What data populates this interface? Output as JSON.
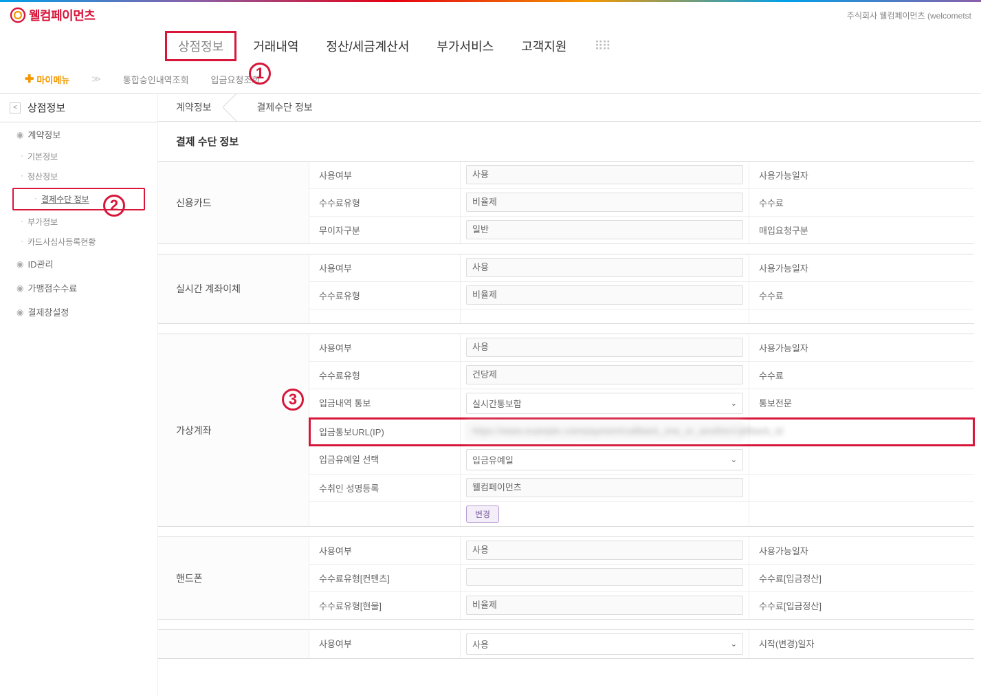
{
  "header": {
    "logo_text": "웰컴페이먼츠",
    "company": "주식회사 웰컴페이먼츠 (welcometst"
  },
  "mainnav": {
    "items": [
      "상점정보",
      "거래내역",
      "정산/세금계산서",
      "부가서비스",
      "고객지원"
    ],
    "active_index": 0
  },
  "submenu": {
    "mymenu": "마이메뉴",
    "items": [
      "통합승인내역조회",
      "입금요청조회"
    ]
  },
  "breadcrumb": [
    "계약정보",
    "결제수단 정보"
  ],
  "sidebar": {
    "title": "상점정보",
    "categories": [
      {
        "label": "계약정보",
        "subs": [
          "기본정보",
          "정산정보",
          "결제수단 정보",
          "부가정보",
          "카드사심사등록현황"
        ],
        "active_sub": 2
      },
      {
        "label": "ID관리",
        "subs": []
      },
      {
        "label": "가맹점수수료",
        "subs": []
      },
      {
        "label": "결제창설정",
        "subs": []
      }
    ]
  },
  "page_title": "결제 수단 정보",
  "annotations": {
    "a1": "1",
    "a2": "2",
    "a3": "3"
  },
  "sections": [
    {
      "name": "credit-card",
      "label": "신용카드",
      "rows": [
        {
          "label": "사용여부",
          "value": "사용",
          "type": "box",
          "right": "사용가능일자"
        },
        {
          "label": "수수료유형",
          "value": "비율제",
          "type": "box",
          "right": "수수료"
        },
        {
          "label": "무이자구분",
          "value": "일반",
          "type": "box",
          "right": "매입요청구분"
        }
      ]
    },
    {
      "name": "realtime-transfer",
      "label": "실시간 계좌이체",
      "rows": [
        {
          "label": "사용여부",
          "value": "사용",
          "type": "box",
          "right": "사용가능일자"
        },
        {
          "label": "수수료유형",
          "value": "비율제",
          "type": "box",
          "right": "수수료"
        },
        {
          "label": "",
          "value": "",
          "type": "empty",
          "right": ""
        }
      ]
    },
    {
      "name": "virtual-account",
      "label": "가상계좌",
      "rows": [
        {
          "label": "사용여부",
          "value": "사용",
          "type": "box",
          "right": "사용가능일자"
        },
        {
          "label": "수수료유형",
          "value": "건당제",
          "type": "box",
          "right": "수수료"
        },
        {
          "label": "입금내역 통보",
          "value": "실시간통보함",
          "type": "select",
          "right": "통보전문"
        },
        {
          "label": "입금통보URL(IP)",
          "value": "https://www.example.com/payment/callback_one_or_another/callback_id",
          "type": "box-blur",
          "right": "",
          "highlight": true
        },
        {
          "label": "입금유예일 선택",
          "value": "입금유예일",
          "type": "select",
          "right": ""
        },
        {
          "label": "수취인 성명등록",
          "value": "웰컴페이먼츠",
          "type": "box",
          "right": ""
        },
        {
          "label": "",
          "value": "변경",
          "type": "button",
          "right": ""
        }
      ]
    },
    {
      "name": "mobile",
      "label": "핸드폰",
      "rows": [
        {
          "label": "사용여부",
          "value": "사용",
          "type": "box",
          "right": "사용가능일자"
        },
        {
          "label": "수수료유형[컨텐츠]",
          "value": "",
          "type": "box",
          "right": "수수료[입금정산]"
        },
        {
          "label": "수수료유형[현물]",
          "value": "비율제",
          "type": "box",
          "right": "수수료[입금정산]"
        }
      ]
    },
    {
      "name": "next",
      "label": "",
      "rows": [
        {
          "label": "사용여부",
          "value": "사용",
          "type": "select",
          "right": "시작(변경)일자"
        }
      ]
    }
  ]
}
